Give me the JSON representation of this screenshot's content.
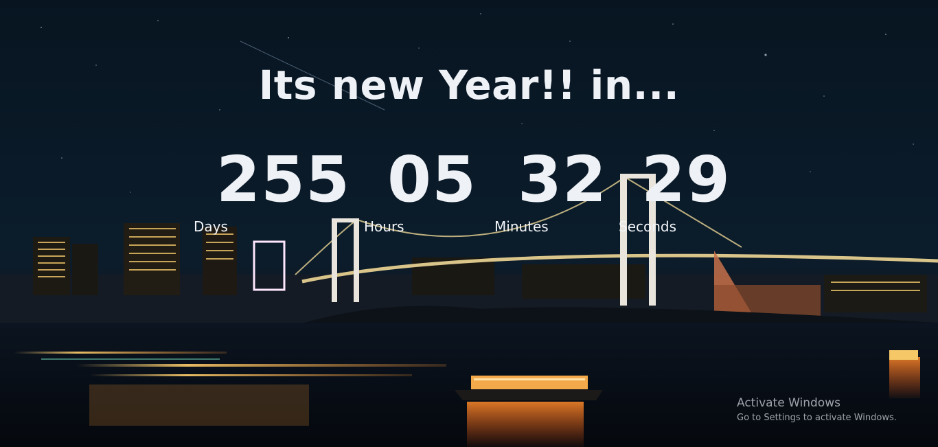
{
  "heading": "Its new Year!! in...",
  "countdown": {
    "days": {
      "value": "255",
      "label": "Days"
    },
    "hours": {
      "value": "05",
      "label": "Hours"
    },
    "minutes": {
      "value": "32",
      "label": "Minutes"
    },
    "seconds": {
      "value": "29",
      "label": "Seconds"
    }
  },
  "watermark": {
    "title": "Activate Windows",
    "subtitle": "Go to Settings to activate Windows."
  }
}
